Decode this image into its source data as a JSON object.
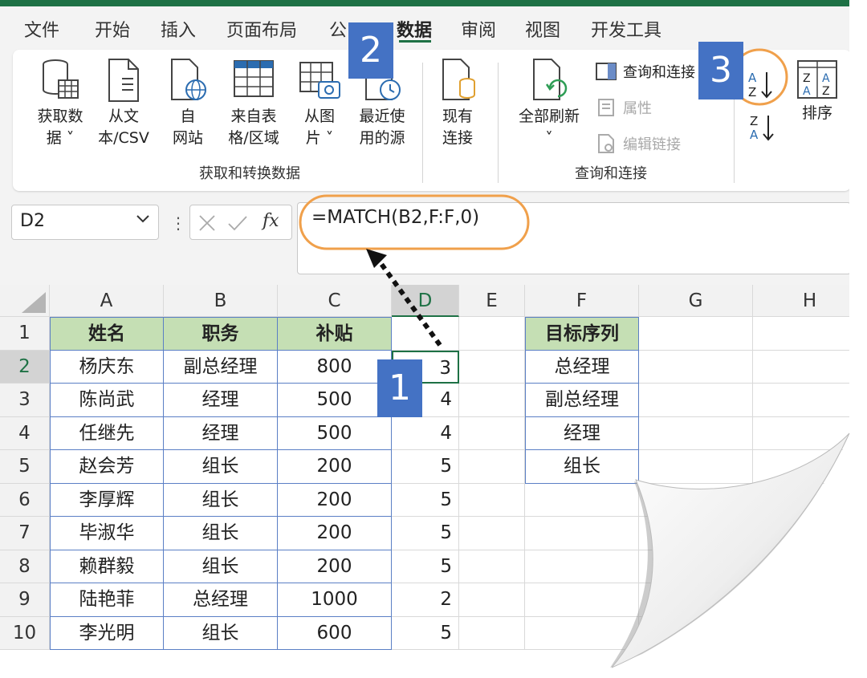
{
  "ribbon_tabs": [
    "文件",
    "开始",
    "插入",
    "页面布局",
    "公",
    "数据",
    "审阅",
    "视图",
    "开发工具"
  ],
  "active_tab": "数据",
  "get_transform": {
    "buttons": [
      {
        "label": "获取数\n据 ˅",
        "icon": "database-table-icon"
      },
      {
        "label": "从文\n本/CSV",
        "icon": "text-file-icon"
      },
      {
        "label": "自\n网站",
        "icon": "web-page-icon"
      },
      {
        "label": "来自表\n格/区域",
        "icon": "table-range-icon"
      },
      {
        "label": "从图\n片 ˅",
        "icon": "picture-table-icon"
      },
      {
        "label": "最近使\n用的源",
        "icon": "recent-sources-icon"
      },
      {
        "label": "现有\n连接",
        "icon": "existing-connections-icon"
      }
    ],
    "group_label": "获取和转换数据"
  },
  "queries": {
    "refresh_label": "全部刷新",
    "refresh_arrow": "˅",
    "commands": [
      {
        "label": "查询和连接",
        "icon": "queries-pane-icon",
        "enabled": true
      },
      {
        "label": "属性",
        "icon": "properties-icon",
        "enabled": false
      },
      {
        "label": "编辑链接",
        "icon": "edit-links-icon",
        "enabled": false
      }
    ],
    "group_label": "查询和连接"
  },
  "sort": {
    "sort_az_icon": "sort-a-to-z-icon",
    "sort_za_icon": "sort-z-to-a-icon",
    "sort_label": "排序",
    "az_glyph": "A\nZ",
    "za_glyph": "Z\nA",
    "sort_glyph": "Z A\nA Z"
  },
  "badges": {
    "step1": "1",
    "step2": "2",
    "step3": "3"
  },
  "name_box": "D2",
  "fx_glyph": "fx",
  "formula": "=MATCH(B2,F:F,0)",
  "columns": [
    "A",
    "B",
    "C",
    "D",
    "E",
    "F",
    "G",
    "H"
  ],
  "rows": [
    "1",
    "2",
    "3",
    "4",
    "5",
    "6",
    "7",
    "8",
    "9",
    "10"
  ],
  "table_headers": {
    "A": "姓名",
    "B": "职务",
    "C": "补贴",
    "F": "目标序列"
  },
  "table_rows": [
    {
      "name": "杨庆东",
      "title": "副总经理",
      "allowance": "800",
      "match": "3"
    },
    {
      "name": "陈尚武",
      "title": "经理",
      "allowance": "500",
      "match": "4"
    },
    {
      "name": "任继先",
      "title": "经理",
      "allowance": "500",
      "match": "4"
    },
    {
      "name": "赵会芳",
      "title": "组长",
      "allowance": "200",
      "match": "5"
    },
    {
      "name": "李厚辉",
      "title": "组长",
      "allowance": "200",
      "match": "5"
    },
    {
      "name": "毕淑华",
      "title": "组长",
      "allowance": "200",
      "match": "5"
    },
    {
      "name": "赖群毅",
      "title": "组长",
      "allowance": "200",
      "match": "5"
    },
    {
      "name": "陆艳菲",
      "title": "总经理",
      "allowance": "1000",
      "match": "2"
    },
    {
      "name": "李光明",
      "title": "组长",
      "allowance": "600",
      "match": "5"
    }
  ],
  "target_sequence": [
    "总经理",
    "副总经理",
    "经理",
    "组长"
  ],
  "colors": {
    "header_fill": "#c5dfb4",
    "excel_green": "#1e7145",
    "badge_blue": "#4472c4",
    "callout_orange": "#f0a04b",
    "table_border": "#5b7fc5"
  }
}
